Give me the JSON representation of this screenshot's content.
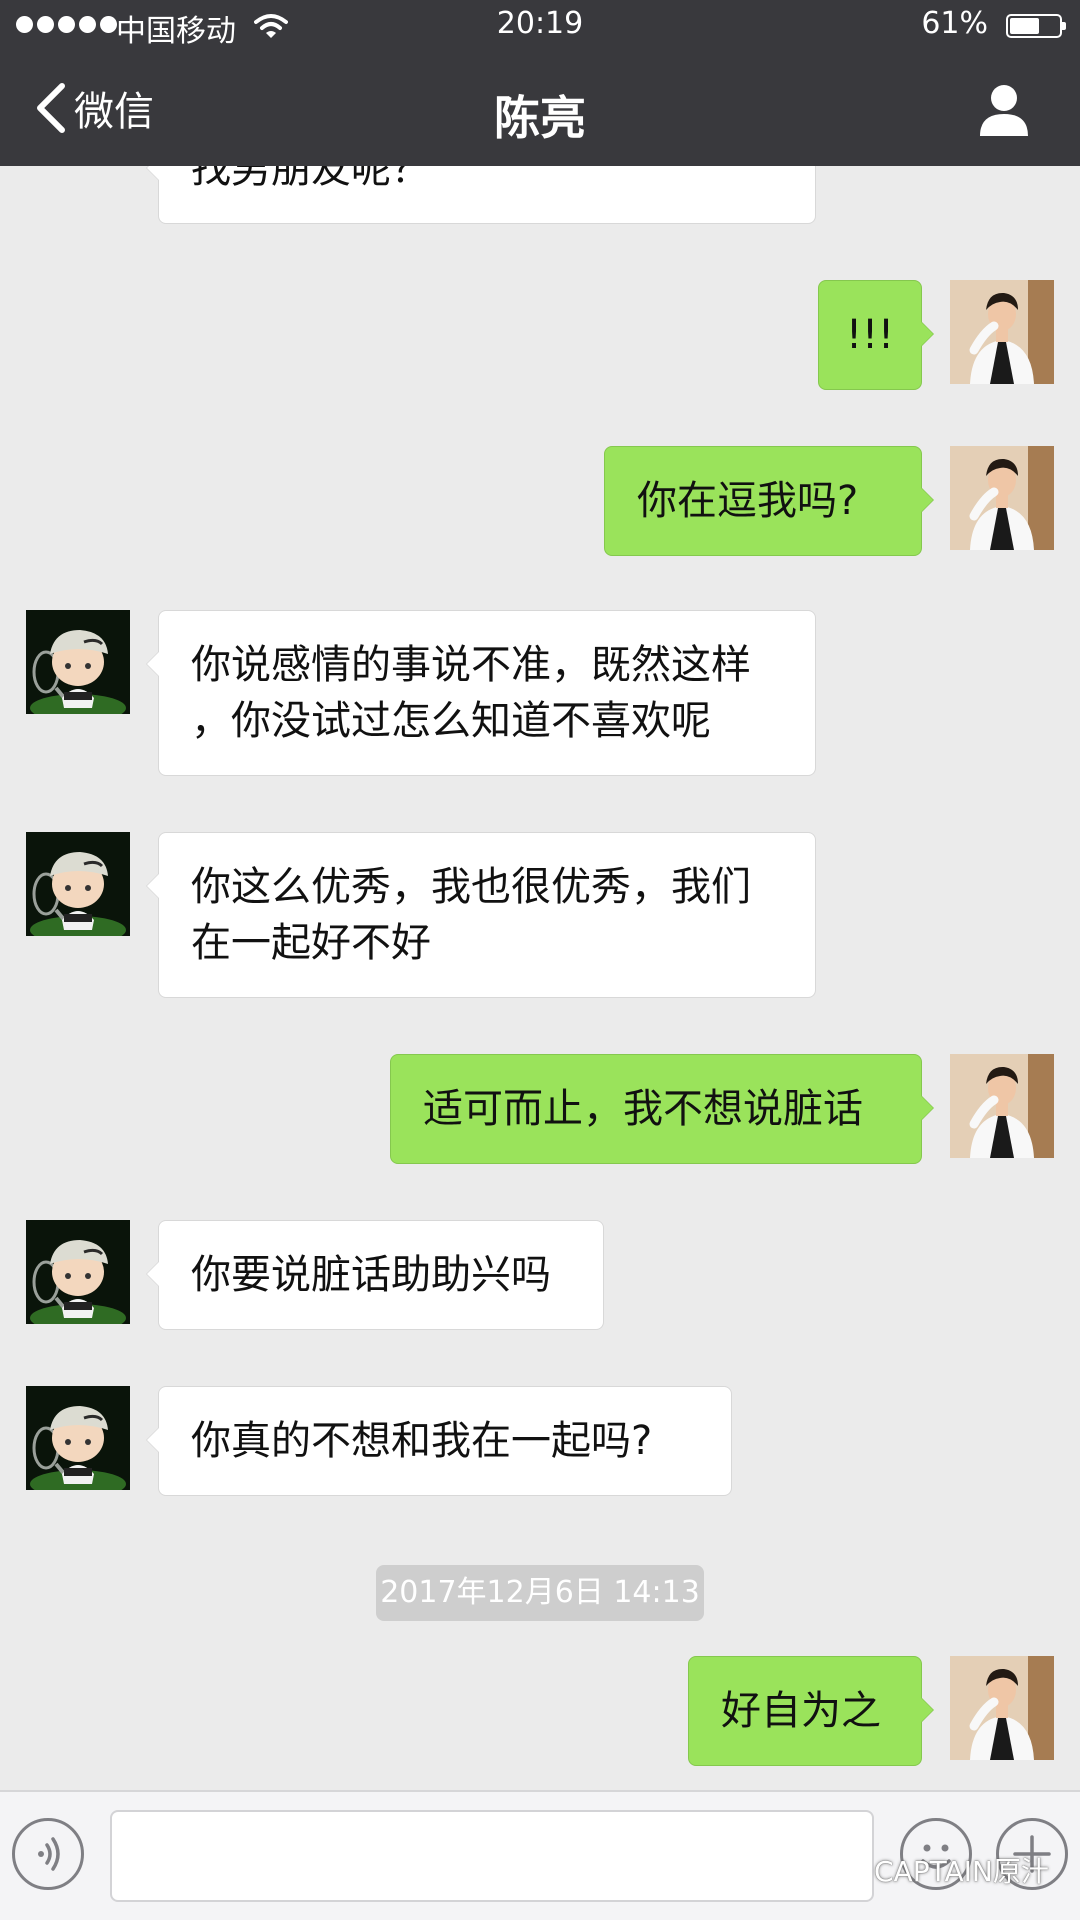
{
  "status_bar": {
    "carrier": "中国移动",
    "time": "20:19",
    "battery_percent": "61%",
    "battery_level": 0.61,
    "signal_bars": 5
  },
  "nav": {
    "back_label": "微信",
    "title": "陈亮",
    "icons": {
      "back": "chevron-left-icon",
      "contact": "person-icon"
    }
  },
  "messages": [
    {
      "sender": "other",
      "text": "找男朋友呢？"
    },
    {
      "sender": "self",
      "text": "!!!"
    },
    {
      "sender": "self",
      "text": "你在逗我吗?"
    },
    {
      "sender": "other",
      "text": "你说感情的事说不准，既然这样\n，你没试过怎么知道不喜欢呢"
    },
    {
      "sender": "other",
      "text": "你这么优秀，我也很优秀，我们\n在一起好不好"
    },
    {
      "sender": "self",
      "text": "适可而止，我不想说脏话"
    },
    {
      "sender": "other",
      "text": "你要说脏话助助兴吗"
    },
    {
      "sender": "other",
      "text": "你真的不想和我在一起吗?"
    },
    {
      "sender": "self",
      "text": "好自为之"
    }
  ],
  "timestamp": "2017年12月6日 14:13",
  "input_bar": {
    "value": "",
    "icons": {
      "voice": "voice-icon",
      "emoji": "emoji-icon",
      "more": "plus-icon"
    }
  },
  "watermark": "CAPTAIN原汁",
  "colors": {
    "nav_background": "#39393d",
    "chat_background": "#ebebeb",
    "self_bubble": "#9ae35b",
    "other_bubble": "#ffffff"
  }
}
